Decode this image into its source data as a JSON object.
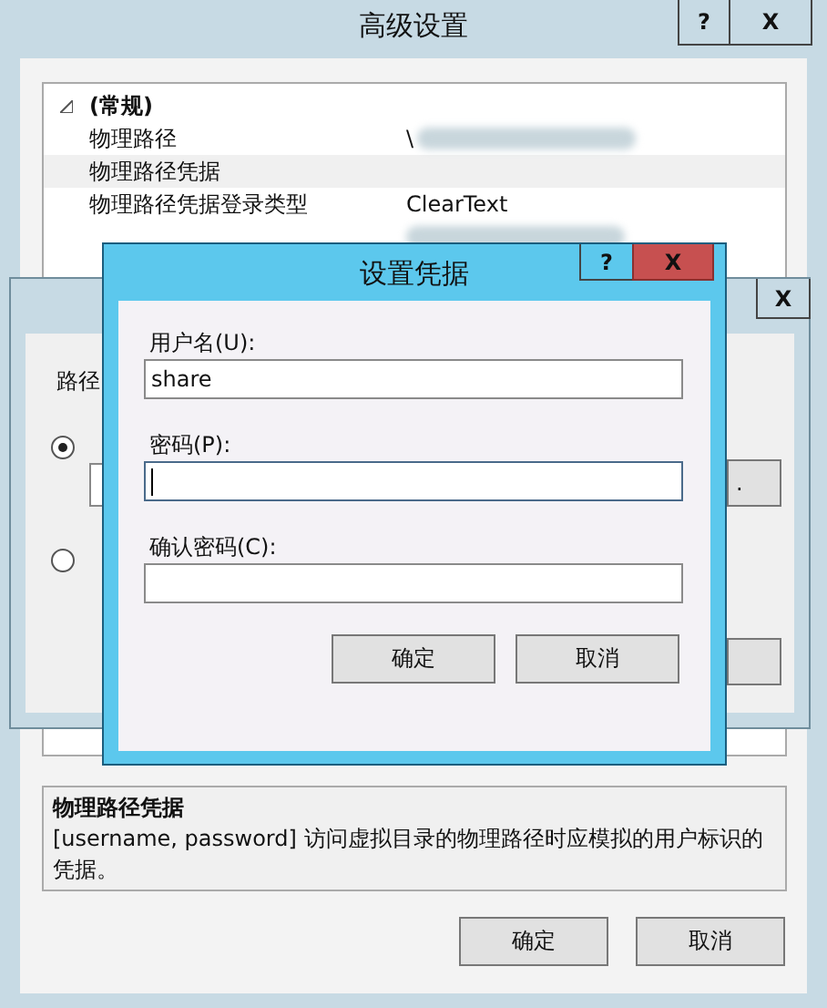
{
  "main_window": {
    "title": "高级设置",
    "help_button": "?",
    "close_button": "X",
    "properties": [
      {
        "kind": "category",
        "name": "(常规)",
        "expanded": true
      },
      {
        "kind": "row",
        "name": "物理路径",
        "value": "\\",
        "redacted": true,
        "selected": false
      },
      {
        "kind": "row",
        "name": "物理路径凭据",
        "redacted": false,
        "selected": true
      },
      {
        "kind": "row",
        "name": "物理路径凭据登录类型",
        "value": "ClearText",
        "redacted": false,
        "selected": false
      },
      {
        "kind": "row",
        "redacted": true,
        "selected": false
      }
    ],
    "description": {
      "title": "物理路径凭据",
      "text": "[username, password] 访问虚拟目录的物理路径时应模拟的用户标识的凭据。"
    },
    "buttons": [
      "确定",
      "取消"
    ]
  },
  "path_dialog": {
    "close_button": "X",
    "group_label": "路径",
    "options": [
      {
        "selected": true
      },
      {
        "selected": false
      }
    ],
    "browse_button": "."
  },
  "credentials_dialog": {
    "title": "设置凭据",
    "help_button": "?",
    "close_button": "X",
    "fields": [
      {
        "label": "用户名(U):",
        "value": "share",
        "focused": false
      },
      {
        "label": "密码(P):",
        "focused": true
      },
      {
        "label": "确认密码(C):",
        "focused": false
      }
    ],
    "buttons": [
      "确定",
      "取消"
    ]
  }
}
